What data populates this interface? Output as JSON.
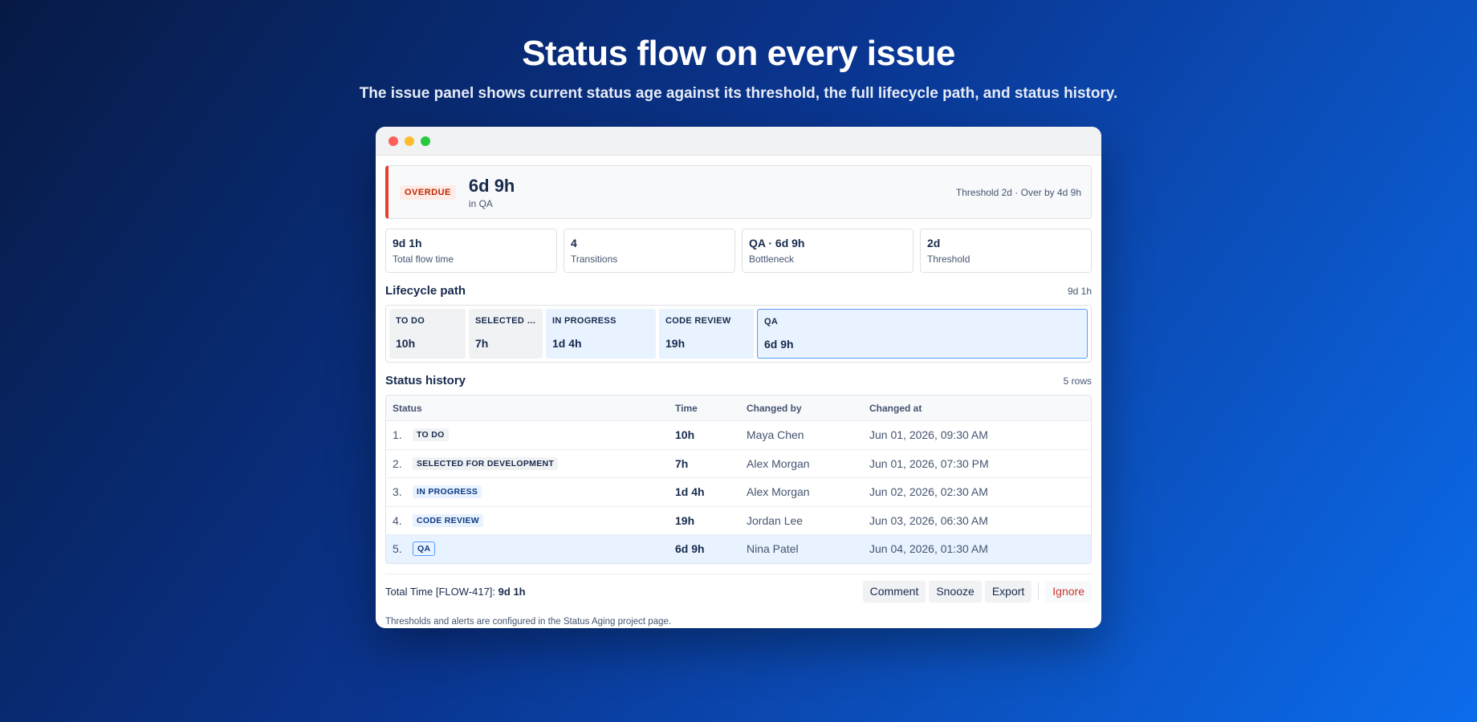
{
  "hero": {
    "title": "Status flow on every issue",
    "subtitle": "The issue panel shows current status age against its threshold, the full lifecycle path, and status history."
  },
  "alert": {
    "badge": "OVERDUE",
    "value": "6d 9h",
    "sub": "in QA",
    "detail": "Threshold 2d · Over by 4d 9h"
  },
  "stats": [
    {
      "value": "9d 1h",
      "label": "Total flow time"
    },
    {
      "value": "4",
      "label": "Transitions"
    },
    {
      "value": "QA · 6d 9h",
      "label": "Bottleneck"
    },
    {
      "value": "2d",
      "label": "Threshold"
    }
  ],
  "lifecycle": {
    "title": "Lifecycle path",
    "total": "9d 1h",
    "stages": [
      {
        "name": "TO DO",
        "time": "10h"
      },
      {
        "name": "SELECTED FOR DEVELOPMENT",
        "time": "7h"
      },
      {
        "name": "IN PROGRESS",
        "time": "1d 4h"
      },
      {
        "name": "CODE REVIEW",
        "time": "19h"
      },
      {
        "name": "QA",
        "time": "6d 9h"
      }
    ]
  },
  "history": {
    "title": "Status history",
    "count": "5 rows",
    "columns": [
      "Status",
      "Time",
      "Changed by",
      "Changed at"
    ],
    "rows": [
      {
        "num": "1.",
        "status": "TO DO",
        "time": "10h",
        "by": "Maya Chen",
        "at": "Jun 01, 2026, 09:30 AM"
      },
      {
        "num": "2.",
        "status": "SELECTED FOR DEVELOPMENT",
        "time": "7h",
        "by": "Alex Morgan",
        "at": "Jun 01, 2026, 07:30 PM"
      },
      {
        "num": "3.",
        "status": "IN PROGRESS",
        "time": "1d 4h",
        "by": "Alex Morgan",
        "at": "Jun 02, 2026, 02:30 AM"
      },
      {
        "num": "4.",
        "status": "CODE REVIEW",
        "time": "19h",
        "by": "Jordan Lee",
        "at": "Jun 03, 2026, 06:30 AM"
      },
      {
        "num": "5.",
        "status": "QA",
        "time": "6d 9h",
        "by": "Nina Patel",
        "at": "Jun 04, 2026, 01:30 AM"
      }
    ]
  },
  "footer": {
    "total_label": "Total Time [FLOW-417]:",
    "total_value": "9d 1h",
    "actions": {
      "comment": "Comment",
      "snooze": "Snooze",
      "export": "Export",
      "ignore": "Ignore"
    },
    "note": "Thresholds and alerts are configured in the Status Aging project page."
  },
  "colors": {
    "overdue": "#e0452b",
    "accent_blue": "#579dff",
    "danger_text": "#c9372c"
  }
}
